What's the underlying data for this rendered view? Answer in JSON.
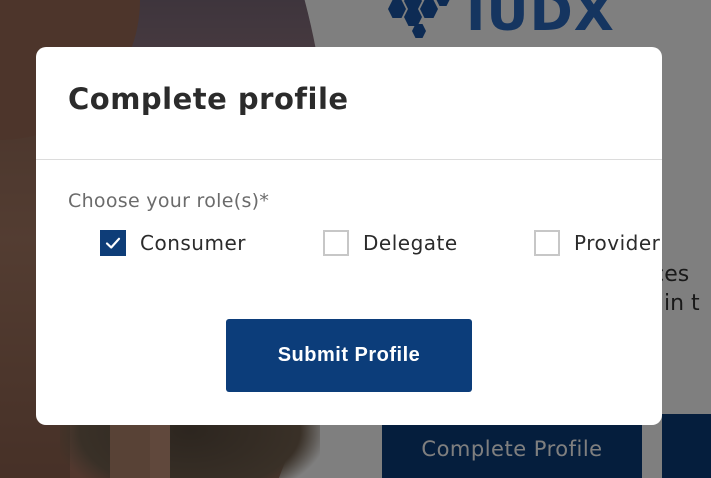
{
  "background": {
    "logo_text": "IUDX",
    "text_line_1": "cces",
    "text_line_2": "gin t",
    "complete_profile_button": "Complete Profile"
  },
  "modal": {
    "title": "Complete profile",
    "role_label": "Choose your role(s)*",
    "roles": [
      {
        "label": "Consumer",
        "checked": true
      },
      {
        "label": "Delegate",
        "checked": false
      },
      {
        "label": "Provider",
        "checked": false
      }
    ],
    "submit_label": "Submit Profile"
  },
  "colors": {
    "primary": "#0c3d7a",
    "overlay": "rgba(0,0,0,0.5)",
    "logo": "#2a6ac0"
  }
}
